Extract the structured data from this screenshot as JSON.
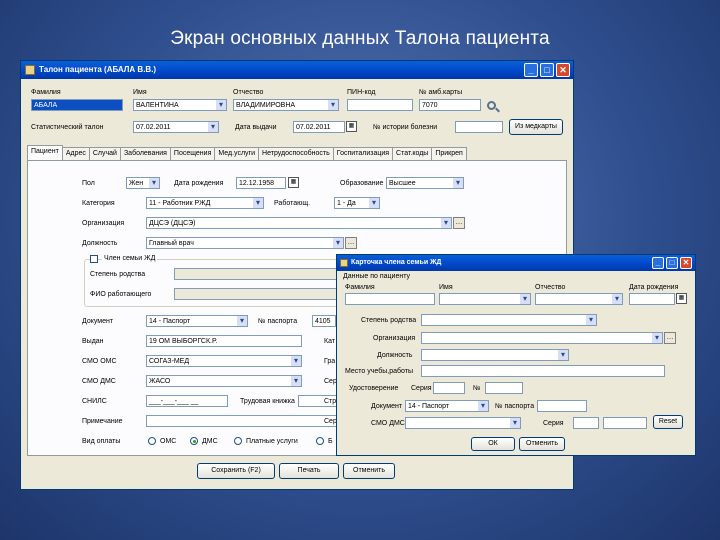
{
  "slide": {
    "title": "Экран основных данных Талона пациента"
  },
  "main": {
    "title": "Талон пациента (АБАЛА В.В.)",
    "header_fields": {
      "surname_label": "Фамилия",
      "surname_value": "АБАЛА",
      "name_label": "Имя",
      "name_value": "ВАЛЕНТИНА",
      "patronymic_label": "Отчество",
      "patronymic_value": "ВЛАДИМИРОВНА",
      "pin_label": "ПИН-код",
      "pin_value": "",
      "card_label": "№ амб.карты",
      "card_value": "7070",
      "stat_label": "Статистический талон",
      "stat_value": "07.02.2011",
      "issue_label": "Дата выдачи",
      "issue_value": "07.02.2011",
      "history_label": "№ истории болезни",
      "history_value": "",
      "history_button": "Из медкарты"
    },
    "tabs": [
      "Пациент",
      "Адрес",
      "Случай",
      "Заболевания",
      "Посещения",
      "Мед.услуги",
      "Нетрудоспособность",
      "Госпитализация",
      "Стат.коды",
      "Прикреп"
    ],
    "patient": {
      "sex_label": "Пол",
      "sex_value": "Жен",
      "birth_label": "Дата рождения",
      "birth_value": "12.12.1958",
      "edu_label": "Образование",
      "edu_value": "Высшее",
      "cat_label": "Категория",
      "cat_value": "11 - Работник РЖД",
      "worker_label": "Работающ.",
      "worker_value": "1 - Да",
      "org_label": "Организация",
      "org_value": "ДЦСЭ (ДЦСЭ)",
      "post_label": "Должность",
      "post_value": "Главный врач",
      "family_label": "Член семьи ЖД",
      "kin_label": "Степень родства",
      "worker_name_label": "ФИО работающего",
      "doc_label": "Документ",
      "doc_value": "14 - Паспорт",
      "passport_label": "№ паспорта",
      "passport_value": "4105",
      "issued_label": "Выдан",
      "issued_value": "19 ОМ ВЫБОРГСК.Р.",
      "smo_oms_label": "СМО ОМС",
      "smo_oms_value": "СОГАЗ-МЕД",
      "smo_dms_label": "СМО ДМС",
      "smo_dms_value": "ЖАСО",
      "snils_label": "СНИЛС",
      "snils_value": "___-___-___ __",
      "labor_label": "Трудовая книжка",
      "note_label": "Примечание",
      "pay_label": "Вид оплаты",
      "pay_options": [
        "ОМС",
        "ДМС",
        "Платные услуги",
        "Б"
      ],
      "cut_labels": [
        "Кат",
        "Гра",
        "Сер",
        "Сер",
        "Стр"
      ]
    },
    "buttons": {
      "save": "Сохранить (F2)",
      "print": "Печать",
      "cancel": "Отменить"
    }
  },
  "family_card": {
    "title": "Карточка члена семьи ЖД",
    "section_label": "Данные по пациенту",
    "surname_label": "Фамилия",
    "name_label": "Имя",
    "patronymic_label": "Отчество",
    "birth_label": "Дата рождения",
    "kin_label": "Степень родства",
    "org_label": "Организация",
    "post_label": "Должность",
    "job_label": "Место учебы,работы",
    "cert_label": "Удостоверение",
    "series_label": "Серия",
    "number_label": "№",
    "doc_label": "Документ",
    "doc_value": "14 - Паспорт",
    "passport_label": "№ паспорта",
    "smo_label": "СМО ДМС",
    "policy_series_label": "Серия",
    "reset_button": "Reset",
    "ok_button": "ОК",
    "cancel_button": "Отменить"
  }
}
